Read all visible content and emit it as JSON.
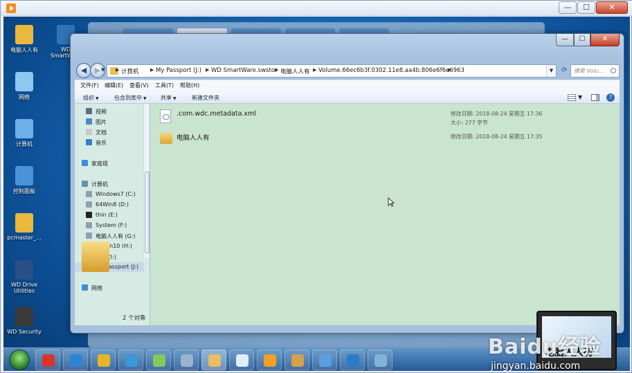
{
  "host": {
    "controls": {
      "minimize": "—",
      "maximize": "☐",
      "close": "✕"
    }
  },
  "desktop": {
    "icons": [
      {
        "label": "电脑人人有",
        "icon": "folder-icon",
        "color": "#e8b93b"
      },
      {
        "label": "WD SmartWare",
        "icon": "wd-smartware-icon",
        "color": "#2f75b5"
      },
      {
        "label": "网络",
        "icon": "network-icon",
        "color": "#8ec7f0"
      },
      {
        "label": "计算机",
        "icon": "computer-icon",
        "color": "#6fb0e8"
      },
      {
        "label": "控制面板",
        "icon": "control-panel-icon",
        "color": "#4b93d8"
      },
      {
        "label": "pcmaster_...",
        "icon": "folder-icon",
        "color": "#e8b93b"
      },
      {
        "label": "WD Drive Utilities",
        "icon": "wd-drive-icon",
        "color": "#2a4e86"
      },
      {
        "label": "WD Security",
        "icon": "wd-security-icon",
        "color": "#3a3a3a"
      }
    ]
  },
  "explorer": {
    "controls": {
      "minimize": "—",
      "maximize": "☐",
      "close": "✕"
    },
    "breadcrumbs": [
      "计算机",
      "My Passport (J:)",
      "WD SmartWare.swstor",
      "电脑人人有",
      "Volume.66ec6b3f.0302.11e8.aa4b.806e6f6e6963"
    ],
    "search_placeholder": "搜索 Volu...",
    "menu": [
      "文件(F)",
      "编辑(E)",
      "查看(V)",
      "工具(T)",
      "帮助(H)"
    ],
    "toolbar": {
      "organize": "组织",
      "include": "包含到库中",
      "share": "共享",
      "new_folder": "新建文件夹"
    },
    "nav_items": [
      {
        "label": "视频",
        "color": "#5b6e86",
        "indent": 1
      },
      {
        "label": "图片",
        "color": "#4e8ac4",
        "indent": 1
      },
      {
        "label": "文档",
        "color": "#c9c9c9",
        "indent": 1
      },
      {
        "label": "音乐",
        "color": "#3a7dc7",
        "indent": 1
      },
      {
        "label": "家庭组",
        "color": "#3a8fd6",
        "indent": 0
      },
      {
        "label": "计算机",
        "color": "#6a8fb6",
        "indent": 0
      },
      {
        "label": "Windows7 (C:)",
        "color": "#8f9fb3",
        "indent": 1
      },
      {
        "label": "64Win8 (D:)",
        "color": "#8f9fb3",
        "indent": 1
      },
      {
        "label": "thin (E:)",
        "color": "#222222",
        "indent": 1
      },
      {
        "label": "System (F:)",
        "color": "#8f9fb3",
        "indent": 1
      },
      {
        "label": "电脑人人有 (G:)",
        "color": "#8f9fb3",
        "indent": 1
      },
      {
        "label": "64Win10 (H:)",
        "color": "#8f9fb3",
        "indent": 1
      },
      {
        "label": "深度 (I:)",
        "color": "#8f9fb3",
        "indent": 1
      },
      {
        "label": "My Passport (J:)",
        "color": "#8f9fb3",
        "indent": 1,
        "selected": true
      },
      {
        "label": "网络",
        "color": "#3a8fd6",
        "indent": 0
      }
    ],
    "files": [
      {
        "name": ".com.wdc.metadata.xml",
        "type": "document",
        "modified": "修改日期: 2018-08-24 星期五 17:36",
        "size": "大小: 277 字节"
      },
      {
        "name": "电脑人人有",
        "type": "folder",
        "modified": "修改日期: 2018-08-24 星期五 17:35",
        "size": ""
      }
    ],
    "status_count": "2 个对象"
  },
  "taskbar": {
    "buttons": [
      {
        "icon": "qihoo-icon",
        "color": "#d9332b"
      },
      {
        "icon": "ie-icon",
        "color": "#2d84d2"
      },
      {
        "icon": "chrome-icon",
        "color": "#e8b425"
      },
      {
        "icon": "browser-icon",
        "color": "#3a97d8"
      },
      {
        "icon": "folder-icon",
        "color": "#86c85c"
      },
      {
        "icon": "network-tool-icon",
        "color": "#9ab3c8"
      },
      {
        "icon": "explorer-icon",
        "color": "#e6c063",
        "active": true
      },
      {
        "icon": "flower-icon",
        "color": "#e0eef8"
      },
      {
        "icon": "media-player-icon",
        "color": "#f0a022"
      },
      {
        "icon": "paint-icon",
        "color": "#d9a04a"
      },
      {
        "icon": "settings-icon",
        "color": "#5aa0e0"
      },
      {
        "icon": "network-center-icon",
        "color": "#2b7bcb"
      },
      {
        "icon": "wd-app-icon",
        "color": "#7fb3d8"
      }
    ]
  },
  "watermark": {
    "main": "Baidu经验",
    "sub": "jingyan.baidu.com",
    "laptop_text": "电脑人人有"
  }
}
